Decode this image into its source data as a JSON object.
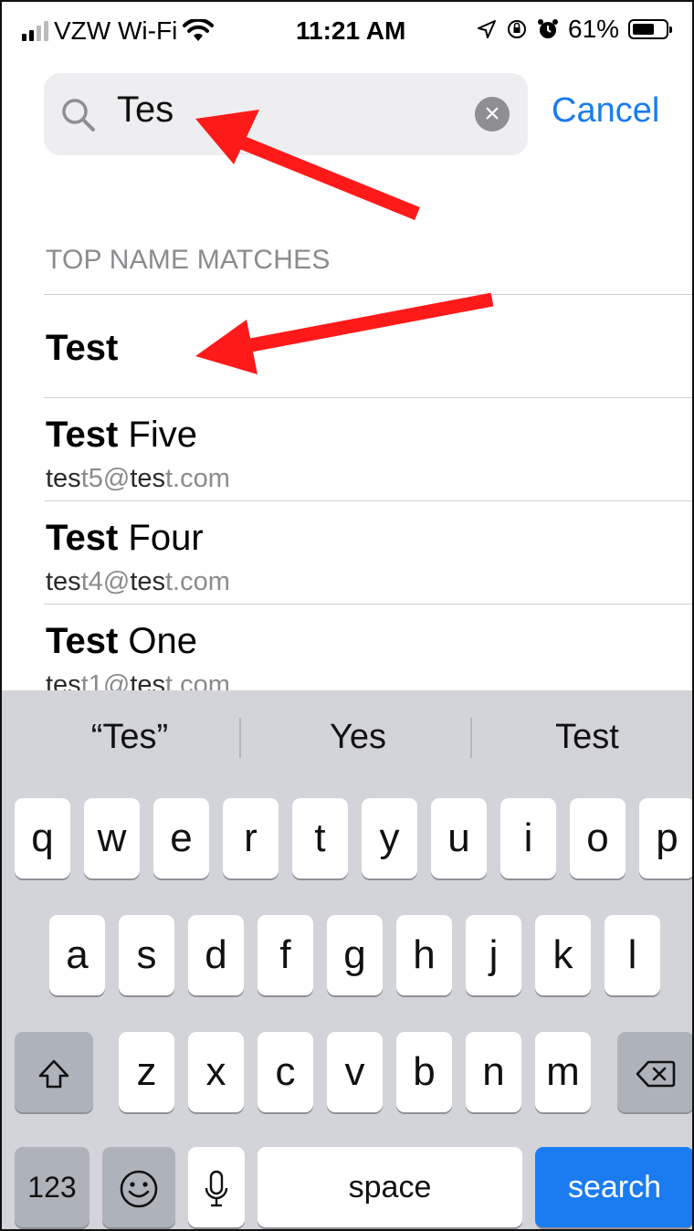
{
  "status_bar": {
    "carrier": "VZW Wi-Fi",
    "time": "11:21 AM",
    "battery": "61%"
  },
  "search": {
    "query": "Tes",
    "cancel_label": "Cancel"
  },
  "section_title": "TOP NAME MATCHES",
  "results": [
    {
      "name_bold": "Test",
      "name_rest": "",
      "email": []
    },
    {
      "name_bold": "Test",
      "name_rest": " Five",
      "email": [
        "tes",
        "t5@",
        "tes",
        "t.com"
      ]
    },
    {
      "name_bold": "Test",
      "name_rest": " Four",
      "email": [
        "tes",
        "t4@",
        "tes",
        "t.com"
      ]
    },
    {
      "name_bold": "Test",
      "name_rest": " One",
      "email": [
        "tes",
        "t1@",
        "tes",
        "t.com"
      ]
    }
  ],
  "keyboard": {
    "predictions": [
      "“Tes”",
      "Yes",
      "Test"
    ],
    "row1": [
      "q",
      "w",
      "e",
      "r",
      "t",
      "y",
      "u",
      "i",
      "o",
      "p"
    ],
    "row2": [
      "a",
      "s",
      "d",
      "f",
      "g",
      "h",
      "j",
      "k",
      "l"
    ],
    "row3": [
      "z",
      "x",
      "c",
      "v",
      "b",
      "n",
      "m"
    ],
    "numbers_label": "123",
    "space_label": "space",
    "search_label": "search"
  },
  "colors": {
    "accent": "#1a7cf0",
    "annotation_arrow": "#ff1a1a"
  }
}
